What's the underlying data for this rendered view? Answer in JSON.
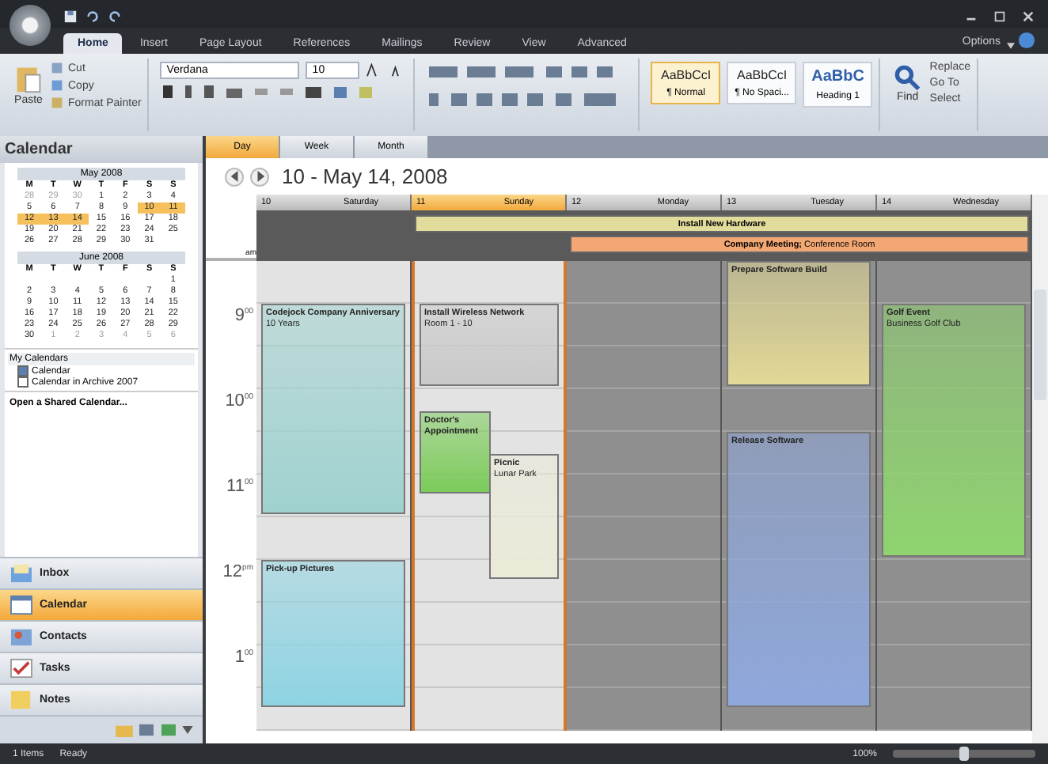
{
  "ribbon": {
    "tabs": [
      {
        "label": "Home",
        "selected": true
      },
      {
        "label": "Insert",
        "selected": false
      },
      {
        "label": "Page Layout",
        "selected": false
      },
      {
        "label": "References",
        "selected": false
      },
      {
        "label": "Mailings",
        "selected": false
      },
      {
        "label": "Review",
        "selected": false
      },
      {
        "label": "View",
        "selected": false
      },
      {
        "label": "Advanced",
        "selected": false
      }
    ],
    "options": "Options",
    "clipboard": {
      "paste": "Paste",
      "items": [
        "Cut",
        "Copy",
        "Format Painter"
      ]
    },
    "font": {
      "name": "Verdana",
      "size": "10"
    },
    "styles": [
      {
        "sample": "AaBbCcI",
        "name": "¶ Normal",
        "selected": true
      },
      {
        "sample": "AaBbCcI",
        "name": "¶ No Spaci...",
        "selected": false
      },
      {
        "sample": "AaBbC",
        "name": "Heading 1",
        "selected": false
      }
    ],
    "editing": {
      "find": "Find",
      "items": [
        "Replace",
        "Go To",
        "Select"
      ]
    }
  },
  "navigation": {
    "title": "Calendar",
    "months": [
      {
        "title": "May 2008",
        "weekdays": [
          "M",
          "T",
          "W",
          "T",
          "F",
          "S",
          "S"
        ],
        "weeks": [
          [
            {
              "d": "28",
              "outside": true,
              "selected": false
            },
            {
              "d": "29",
              "outside": true,
              "selected": false
            },
            {
              "d": "30",
              "outside": true,
              "selected": false
            },
            {
              "d": "1",
              "outside": false,
              "selected": false
            },
            {
              "d": "2",
              "outside": false,
              "selected": false
            },
            {
              "d": "3",
              "outside": false,
              "selected": false
            },
            {
              "d": "4",
              "outside": false,
              "selected": false
            }
          ],
          [
            {
              "d": "5",
              "outside": false,
              "selected": false
            },
            {
              "d": "6",
              "outside": false,
              "selected": false
            },
            {
              "d": "7",
              "outside": false,
              "selected": false
            },
            {
              "d": "8",
              "outside": false,
              "selected": false
            },
            {
              "d": "9",
              "outside": false,
              "selected": false
            },
            {
              "d": "10",
              "outside": false,
              "selected": true
            },
            {
              "d": "11",
              "outside": false,
              "selected": true
            }
          ],
          [
            {
              "d": "12",
              "outside": false,
              "selected": true
            },
            {
              "d": "13",
              "outside": false,
              "selected": true
            },
            {
              "d": "14",
              "outside": false,
              "selected": true
            },
            {
              "d": "15",
              "outside": false,
              "selected": false
            },
            {
              "d": "16",
              "outside": false,
              "selected": false
            },
            {
              "d": "17",
              "outside": false,
              "selected": false
            },
            {
              "d": "18",
              "outside": false,
              "selected": false
            }
          ],
          [
            {
              "d": "19",
              "outside": false,
              "selected": false
            },
            {
              "d": "20",
              "outside": false,
              "selected": false
            },
            {
              "d": "21",
              "outside": false,
              "selected": false
            },
            {
              "d": "22",
              "outside": false,
              "selected": false
            },
            {
              "d": "23",
              "outside": false,
              "selected": false
            },
            {
              "d": "24",
              "outside": false,
              "selected": false
            },
            {
              "d": "25",
              "outside": false,
              "selected": false
            }
          ],
          [
            {
              "d": "26",
              "outside": false,
              "selected": false
            },
            {
              "d": "27",
              "outside": false,
              "selected": false
            },
            {
              "d": "28",
              "outside": false,
              "selected": false
            },
            {
              "d": "29",
              "outside": false,
              "selected": false
            },
            {
              "d": "30",
              "outside": false,
              "selected": false
            },
            {
              "d": "31",
              "outside": false,
              "selected": false
            }
          ]
        ]
      },
      {
        "title": "June 2008",
        "weekdays": [
          "M",
          "T",
          "W",
          "T",
          "F",
          "S",
          "S"
        ],
        "weeks": [
          [
            {
              "d": "1",
              "outside": false,
              "selected": false
            }
          ],
          [
            {
              "d": "2",
              "outside": false,
              "selected": false
            },
            {
              "d": "3",
              "outside": false,
              "selected": false
            },
            {
              "d": "4",
              "outside": false,
              "selected": false
            },
            {
              "d": "5",
              "outside": false,
              "selected": false
            },
            {
              "d": "6",
              "outside": false,
              "selected": false
            },
            {
              "d": "7",
              "outside": false,
              "selected": false
            },
            {
              "d": "8",
              "outside": false,
              "selected": false
            }
          ],
          [
            {
              "d": "9",
              "outside": false,
              "selected": false
            },
            {
              "d": "10",
              "outside": false,
              "selected": false
            },
            {
              "d": "11",
              "outside": false,
              "selected": false
            },
            {
              "d": "12",
              "outside": false,
              "selected": false
            },
            {
              "d": "13",
              "outside": false,
              "selected": false
            },
            {
              "d": "14",
              "outside": false,
              "selected": false
            },
            {
              "d": "15",
              "outside": false,
              "selected": false
            }
          ],
          [
            {
              "d": "16",
              "outside": false,
              "selected": false
            },
            {
              "d": "17",
              "outside": false,
              "selected": false
            },
            {
              "d": "18",
              "outside": false,
              "selected": false
            },
            {
              "d": "19",
              "outside": false,
              "selected": false
            },
            {
              "d": "20",
              "outside": false,
              "selected": false
            },
            {
              "d": "21",
              "outside": false,
              "selected": false
            },
            {
              "d": "22",
              "outside": false,
              "selected": false
            }
          ],
          [
            {
              "d": "23",
              "outside": false,
              "selected": false
            },
            {
              "d": "24",
              "outside": false,
              "selected": false
            },
            {
              "d": "25",
              "outside": false,
              "selected": false
            },
            {
              "d": "26",
              "outside": false,
              "selected": false
            },
            {
              "d": "27",
              "outside": false,
              "selected": false
            },
            {
              "d": "28",
              "outside": false,
              "selected": false
            },
            {
              "d": "29",
              "outside": false,
              "selected": false
            }
          ],
          [
            {
              "d": "30",
              "outside": false,
              "selected": false
            },
            {
              "d": "1",
              "outside": true,
              "selected": false
            },
            {
              "d": "2",
              "outside": true,
              "selected": false
            },
            {
              "d": "3",
              "outside": true,
              "selected": false
            },
            {
              "d": "4",
              "outside": true,
              "selected": false
            },
            {
              "d": "5",
              "outside": true,
              "selected": false
            },
            {
              "d": "6",
              "outside": true,
              "selected": false
            }
          ]
        ]
      }
    ],
    "my_calendars": {
      "title": "My Calendars",
      "items": [
        {
          "label": "Calendar",
          "checked": true
        },
        {
          "label": "Calendar in Archive 2007",
          "checked": false
        }
      ]
    },
    "shared_link": "Open a Shared Calendar...",
    "sections": [
      {
        "label": "Inbox",
        "kind": "inbox",
        "selected": false
      },
      {
        "label": "Calendar",
        "kind": "calendar",
        "selected": true
      },
      {
        "label": "Contacts",
        "kind": "contacts",
        "selected": false
      },
      {
        "label": "Tasks",
        "kind": "tasks",
        "selected": false
      },
      {
        "label": "Notes",
        "kind": "notes",
        "selected": false
      }
    ]
  },
  "calendar": {
    "views": [
      {
        "label": "Day",
        "selected": true
      },
      {
        "label": "Week",
        "selected": false
      },
      {
        "label": "Month",
        "selected": false
      }
    ],
    "range": "10 - May 14, 2008",
    "all_day_label": "am",
    "all_day": [
      {
        "title": "Install New Hardware",
        "color": "#e2dc9c"
      },
      {
        "title": "Company Meeting;",
        "location": "Conference Room",
        "color": "#f3a874"
      }
    ],
    "hours": [
      {
        "hour": "9",
        "min": "00"
      },
      {
        "hour": "10",
        "min": "00"
      },
      {
        "hour": "11",
        "min": "00"
      },
      {
        "hour": "12",
        "min": "pm"
      },
      {
        "hour": "1",
        "min": "00"
      }
    ],
    "days": [
      {
        "num": "10",
        "name": "Saturday",
        "selected": false,
        "kind": "free",
        "events": [
          {
            "title": "Codejock Company Anniversary",
            "location": "10 Years",
            "color": "#9fd2cf"
          },
          {
            "title": "Pick-up Pictures",
            "color": "#8ed3e2"
          }
        ]
      },
      {
        "num": "11",
        "name": "Sunday",
        "selected": true,
        "kind": "free",
        "events": [
          {
            "title": "Install Wireless Network",
            "location": "Room 1 - 10",
            "color": "#c9c9c9"
          },
          {
            "title": "Doctor's Appointment",
            "color": "#7ccb5a"
          },
          {
            "title": "Picnic",
            "location": "Lunar Park",
            "color": "#ecead8"
          }
        ]
      },
      {
        "num": "12",
        "name": "Monday",
        "selected": false,
        "kind": "busy"
      },
      {
        "num": "13",
        "name": "Tuesday",
        "selected": false,
        "kind": "busy",
        "events": [
          {
            "title": "Prepare Software Build",
            "color": "#e2d896"
          },
          {
            "title": "Release Software",
            "color": "#8fa8dc"
          }
        ]
      },
      {
        "num": "14",
        "name": "Wednesday",
        "selected": false,
        "kind": "busy",
        "events": [
          {
            "title": "Golf Event",
            "location": "Business Golf Club",
            "color": "#8fd46f"
          }
        ]
      }
    ]
  },
  "status_bar": {
    "items": "1 Items",
    "state": "Ready",
    "zoom": "100%",
    "zoom_slider": {
      "level": 0.5
    }
  }
}
